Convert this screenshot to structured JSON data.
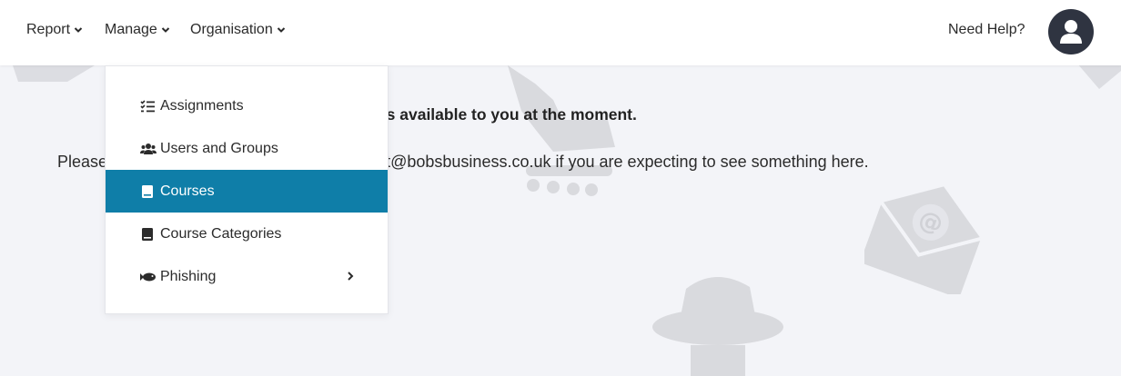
{
  "navbar": {
    "menus": [
      {
        "label": "Report"
      },
      {
        "label": "Manage"
      },
      {
        "label": "Organisation"
      }
    ],
    "help_label": "Need Help?"
  },
  "message": {
    "title": "ourses available to you at the moment.",
    "body": "Please                                                        port@bobsbusiness.co.uk if you are expecting to see something here."
  },
  "dropdown": {
    "items": [
      {
        "label": "Assignments",
        "icon": "list-check-icon"
      },
      {
        "label": "Users and Groups",
        "icon": "users-icon"
      },
      {
        "label": "Courses",
        "icon": "book-icon"
      },
      {
        "label": "Course Categories",
        "icon": "book-icon"
      },
      {
        "label": "Phishing",
        "icon": "fish-icon"
      }
    ]
  },
  "colors": {
    "accent": "#0f7ea8",
    "avatar_bg": "#2f3441",
    "page_bg": "#f3f4f8"
  }
}
